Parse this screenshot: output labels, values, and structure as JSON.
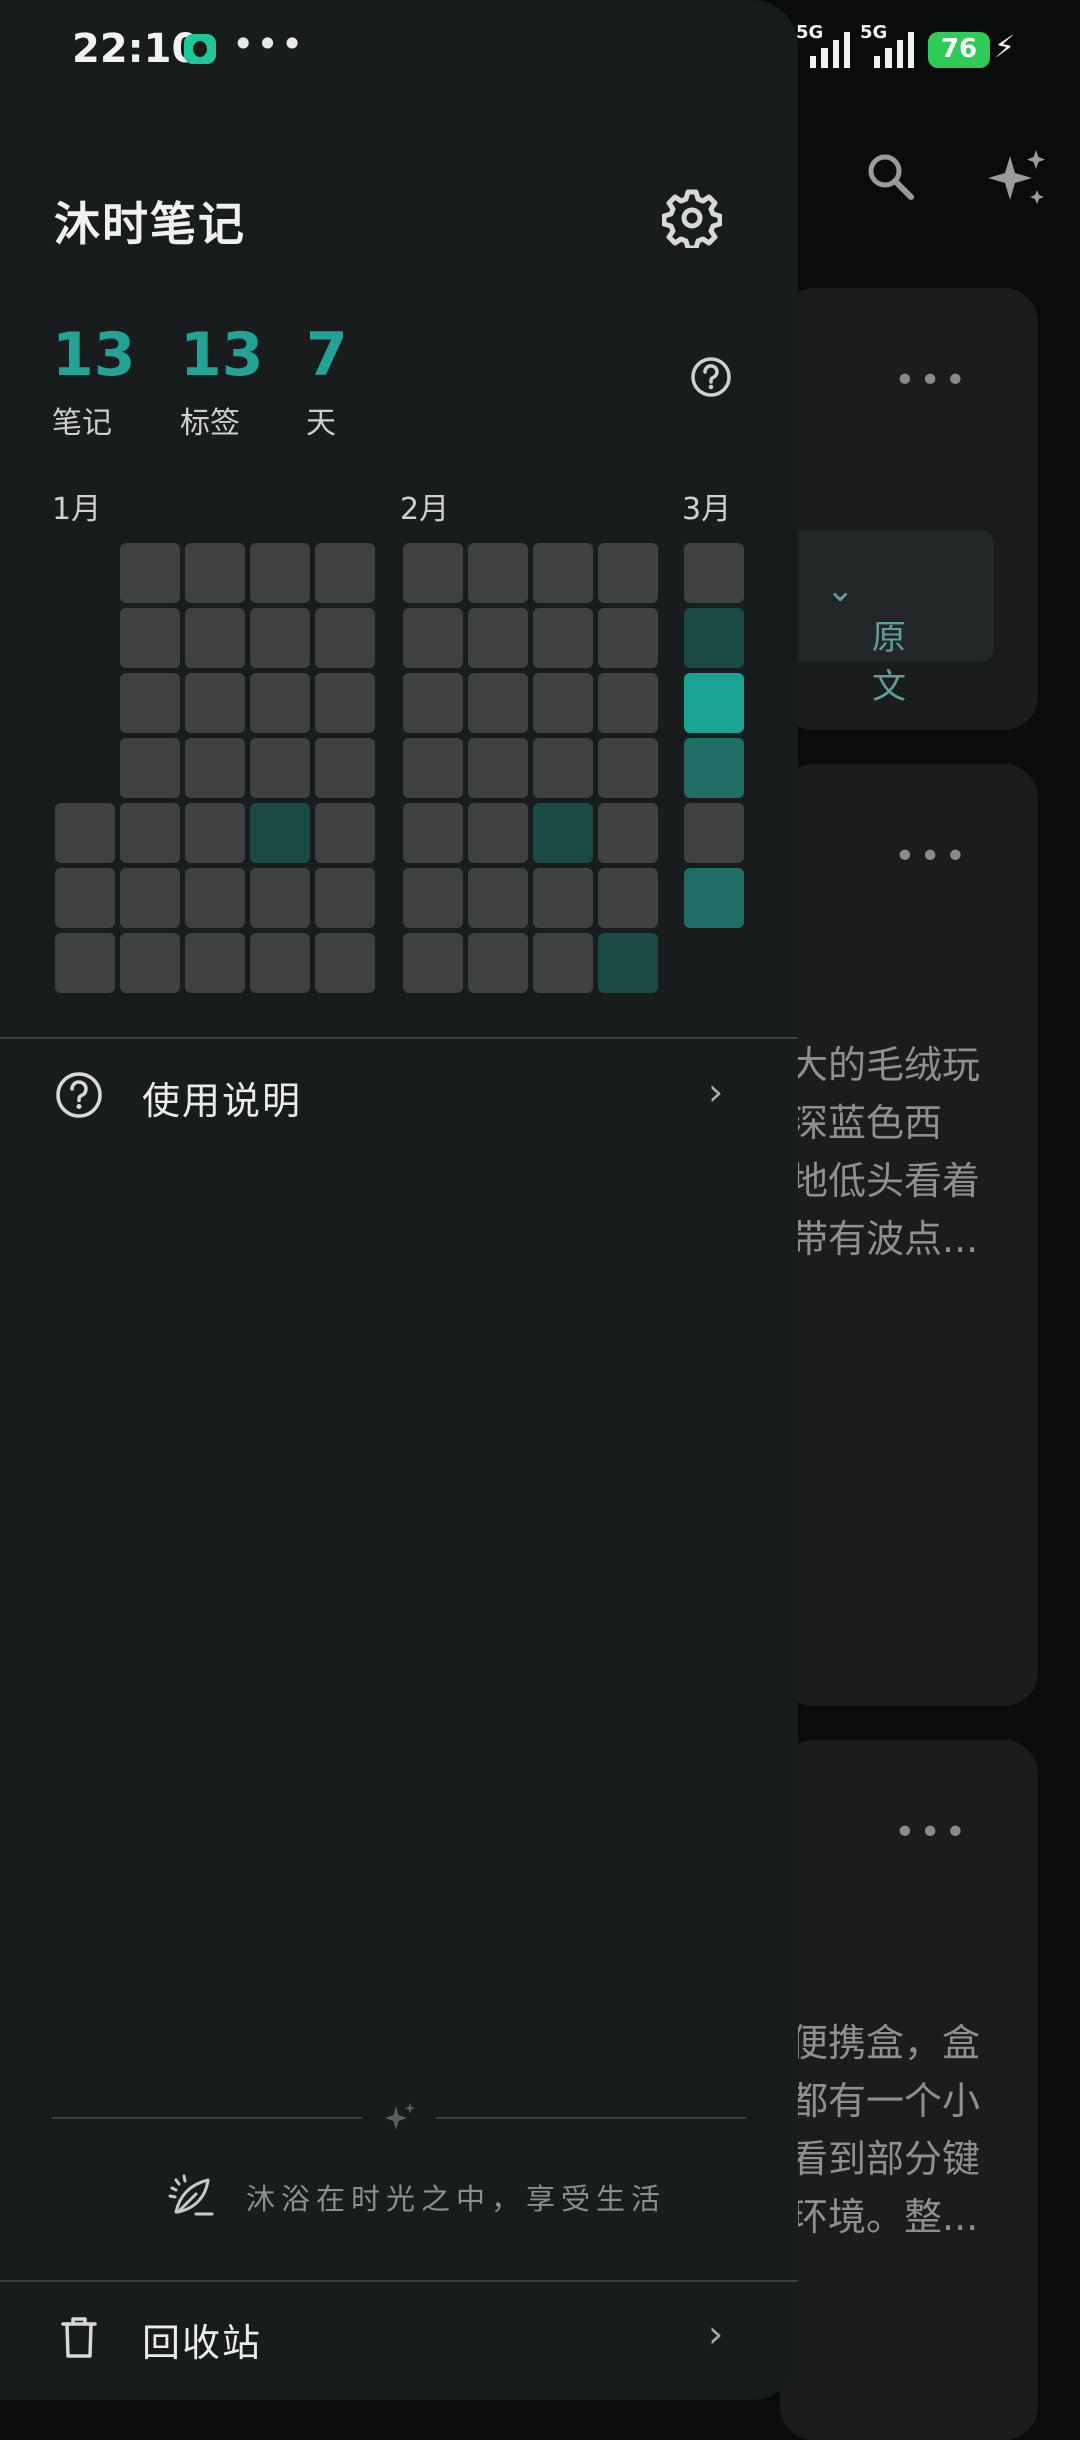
{
  "status_bar": {
    "time": "22:10",
    "signal_1_label": "5G",
    "signal_2_label": "5G",
    "battery": "76"
  },
  "drawer": {
    "app_title": "沐时笔记",
    "stats": [
      {
        "value": "13",
        "label": "笔记"
      },
      {
        "value": "13",
        "label": "标签"
      },
      {
        "value": "7",
        "label": "天"
      }
    ],
    "months": [
      "1月",
      "2月",
      "3月"
    ],
    "heatmap_legend_colors": {
      "empty": "#404142",
      "low": "#1b4a45",
      "mid": "#1f6d64",
      "high": "#1aa392"
    },
    "menu": {
      "instructions_label": "使用说明",
      "trash_label": "回收站"
    },
    "slogan": "沐浴在时光之中，享受生活"
  },
  "background": {
    "original_text_chip": "原文",
    "card2_lines": [
      "大的毛绒玩",
      "深蓝色西",
      "地低头看着",
      "带有波点..."
    ],
    "card3_lines": [
      "便携盒，盒",
      "都有一个小",
      "看到部分键",
      "环境。整..."
    ]
  },
  "colors": {
    "accent": "#24a296",
    "drawer_bg": "#181c1c"
  }
}
